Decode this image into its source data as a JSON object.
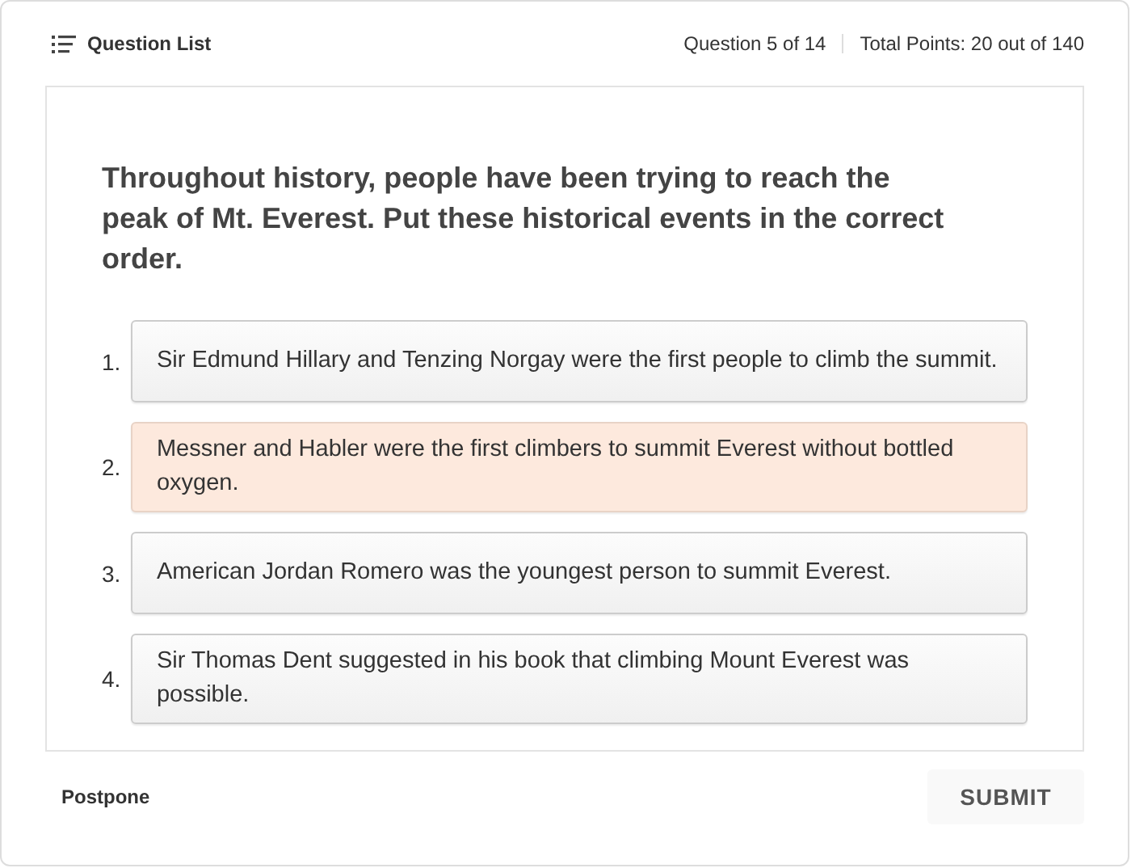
{
  "header": {
    "question_list": "Question List",
    "progress": "Question 5 of 14",
    "points": "Total Points: 20 out of 140"
  },
  "question": "Throughout history, people have been trying to reach the peak of Mt. Everest. Put these historical events in the correct order.",
  "items": [
    {
      "number": "1.",
      "text": "Sir Edmund Hillary and Tenzing Norgay were the first people to climb the summit.",
      "selected": false
    },
    {
      "number": "2.",
      "text": "Messner and Habler were the first climbers to summit Everest without bottled oxygen.",
      "selected": true
    },
    {
      "number": "3.",
      "text": "American Jordan Romero was the youngest person to summit Everest.",
      "selected": false
    },
    {
      "number": "4.",
      "text": "Sir Thomas Dent suggested in his book that climbing Mount Everest was possible.",
      "selected": false
    }
  ],
  "footer": {
    "postpone": "Postpone",
    "submit": "SUBMIT"
  }
}
